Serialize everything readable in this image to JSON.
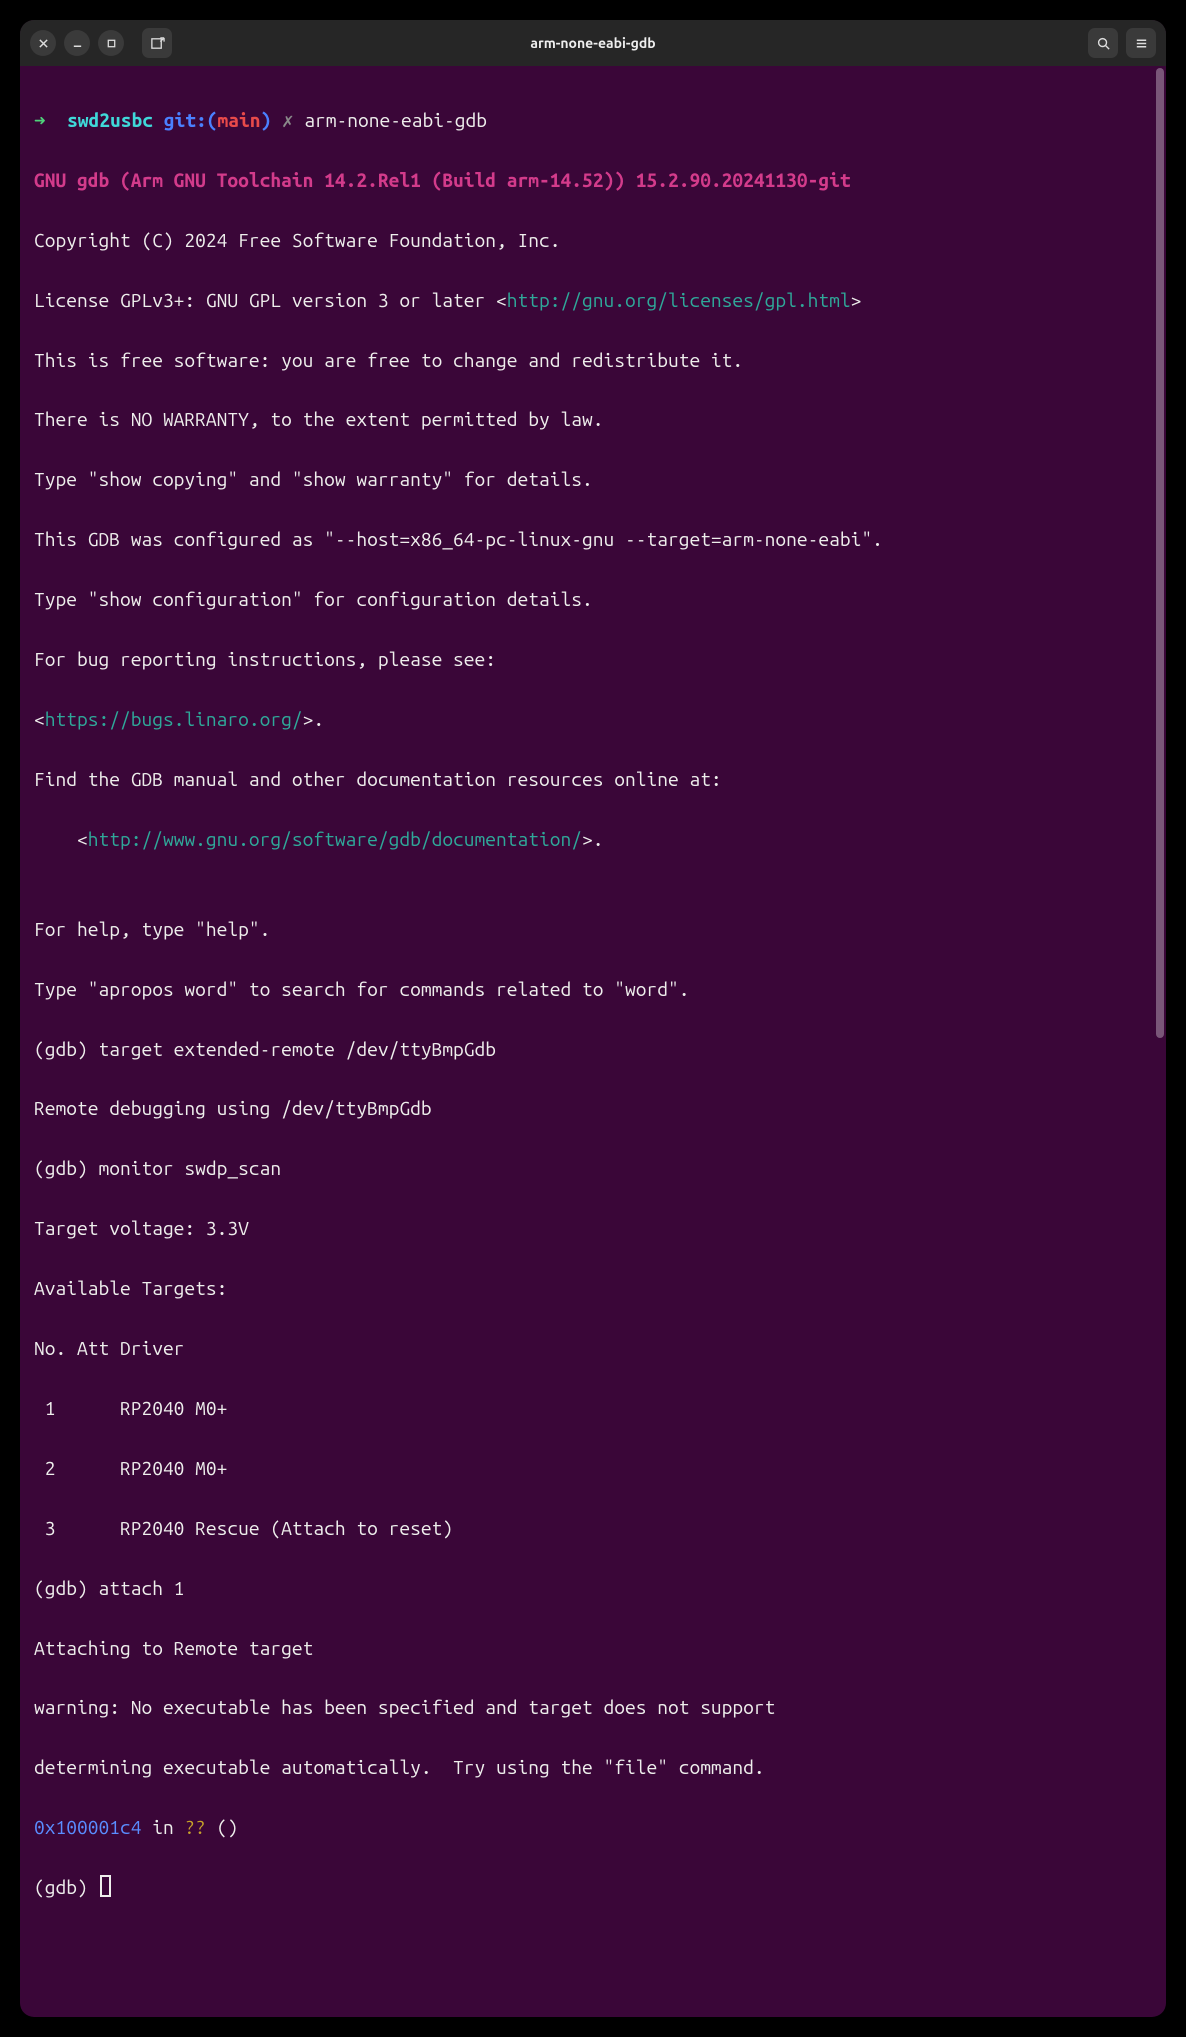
{
  "window": {
    "title": "arm-none-eabi-gdb"
  },
  "prompt": {
    "arrow": "➜",
    "dir": "swd2usbc",
    "git_prefix": "git:(",
    "branch": "main",
    "git_suffix": ")",
    "x": "✗",
    "command": "arm-none-eabi-gdb"
  },
  "banner": "GNU gdb (Arm GNU Toolchain 14.2.Rel1 (Build arm-14.52)) 15.2.90.20241130-git",
  "lines": {
    "copyright": "Copyright (C) 2024 Free Software Foundation, Inc.",
    "license_pre": "License GPLv3+: GNU GPL version 3 or later <",
    "license_url": "http://gnu.org/licenses/gpl.html",
    "license_post": ">",
    "free1": "This is free software: you are free to change and redistribute it.",
    "free2": "There is NO WARRANTY, to the extent permitted by law.",
    "showcopy": "Type \"show copying\" and \"show warranty\" for details.",
    "configured": "This GDB was configured as \"--host=x86_64-pc-linux-gnu --target=arm-none-eabi\".",
    "showconf": "Type \"show configuration\" for configuration details.",
    "bugs": "For bug reporting instructions, please see:",
    "bugs_open": "<",
    "bugs_url": "https://bugs.linaro.org/",
    "bugs_close": ">.",
    "manual": "Find the GDB manual and other documentation resources online at:",
    "manual_indent": "    <",
    "manual_url": "http://www.gnu.org/software/gdb/documentation/",
    "manual_close": ">.",
    "blank": "",
    "help": "For help, type \"help\".",
    "apropos": "Type \"apropos word\" to search for commands related to \"word\".",
    "cmd1": "(gdb) target extended-remote /dev/ttyBmpGdb",
    "remote": "Remote debugging using /dev/ttyBmpGdb",
    "cmd2": "(gdb) monitor swdp_scan",
    "voltage": "Target voltage: 3.3V",
    "avail": "Available Targets:",
    "header": "No. Att Driver",
    "t1": " 1      RP2040 M0+",
    "t2": " 2      RP2040 M0+",
    "t3": " 3      RP2040 Rescue (Attach to reset)",
    "cmd3": "(gdb) attach 1",
    "attaching": "Attaching to Remote target",
    "warn1": "warning: No executable has been specified and target does not support",
    "warn2": "determining executable automatically.  Try using the \"file\" command.",
    "addr": "0x100001c4",
    "inword": " in ",
    "qq": "??",
    "parens": " ()",
    "gdb_prompt": "(gdb) "
  }
}
